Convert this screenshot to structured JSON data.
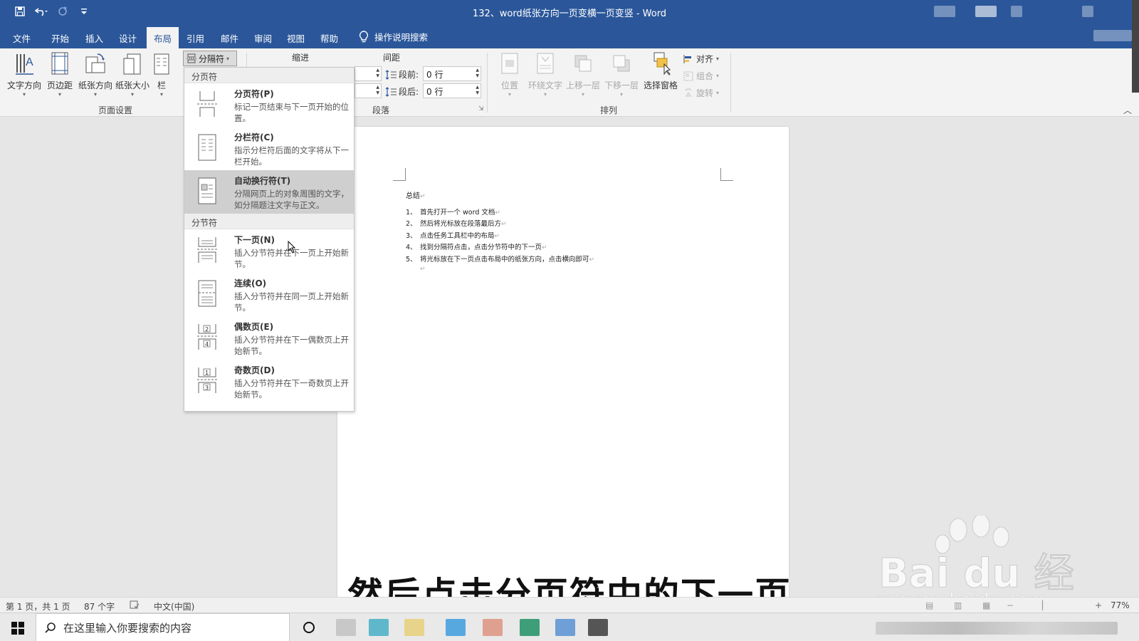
{
  "title_bar": {
    "doc_title": "132、word纸张方向一页变横一页变竖 - Word",
    "qat": {
      "save_icon": "save-icon",
      "undo_icon": "undo-icon",
      "redo_icon": "redo-icon",
      "customize_icon": "customize-qat-icon"
    }
  },
  "tabs": [
    {
      "label": "文件"
    },
    {
      "label": "开始"
    },
    {
      "label": "插入"
    },
    {
      "label": "设计"
    },
    {
      "label": "布局",
      "active": true
    },
    {
      "label": "引用"
    },
    {
      "label": "邮件"
    },
    {
      "label": "审阅"
    },
    {
      "label": "视图"
    },
    {
      "label": "帮助"
    }
  ],
  "tell_me": "操作说明搜索",
  "ribbon": {
    "page_setup": {
      "buttons": [
        "文字方向",
        "页边距",
        "纸张方向",
        "纸张大小",
        "栏"
      ],
      "group_label": "页面设置"
    },
    "breaks_button": "分隔符",
    "paragraph": {
      "indent_label": "缩进",
      "spacing_label": "间距",
      "before_label": "段前:",
      "before_value": "0 行",
      "after_label": "段后:",
      "after_value": "0 行",
      "group_label": "段落"
    },
    "arrange": {
      "buttons": [
        "位置",
        "环绕文字",
        "上移一层",
        "下移一层",
        "选择窗格"
      ],
      "align": "对齐",
      "group": "组合",
      "rotate": "旋转",
      "group_label": "排列"
    }
  },
  "dropdown": {
    "section_page": "分页符",
    "section_section": "分节符",
    "items": [
      {
        "title": "分页符(P)",
        "desc": "标记一页结束与下一页开始的位置。"
      },
      {
        "title": "分栏符(C)",
        "desc": "指示分栏符后面的文字将从下一栏开始。"
      },
      {
        "title": "自动换行符(T)",
        "desc": "分隔网页上的对象周围的文字，如分隔题注文字与正文。"
      },
      {
        "title": "下一页(N)",
        "desc": "插入分节符并在下一页上开始新节。"
      },
      {
        "title": "连续(O)",
        "desc": "插入分节符并在同一页上开始新节。"
      },
      {
        "title": "偶数页(E)",
        "desc": "插入分节符并在下一偶数页上开始新节。"
      },
      {
        "title": "奇数页(D)",
        "desc": "插入分节符并在下一奇数页上开始新节。"
      }
    ]
  },
  "document": {
    "heading": "总结",
    "list": [
      {
        "num": "1、",
        "text": "首先打开一个 word 文档"
      },
      {
        "num": "2、",
        "text": "然后将光标放在段落最后方"
      },
      {
        "num": "3、",
        "text": "点击任务工具栏中的布局"
      },
      {
        "num": "4、",
        "text": "找到分隔符点击，点击分节符中的下一页"
      },
      {
        "num": "5、",
        "text": "将光标放在下一页点击布局中的纸张方向，点击横向即可"
      }
    ]
  },
  "subtitle": "然后点击分页符中的下一页",
  "status_bar": {
    "page": "第 1 页，共 1 页",
    "words": "87 个字",
    "language": "中文(中国)",
    "zoom": "77%"
  },
  "taskbar": {
    "search_placeholder": "在这里输入你要搜索的内容"
  },
  "watermark": {
    "brand": "Bai du 经验",
    "url": "jingyan.baidu.com"
  }
}
